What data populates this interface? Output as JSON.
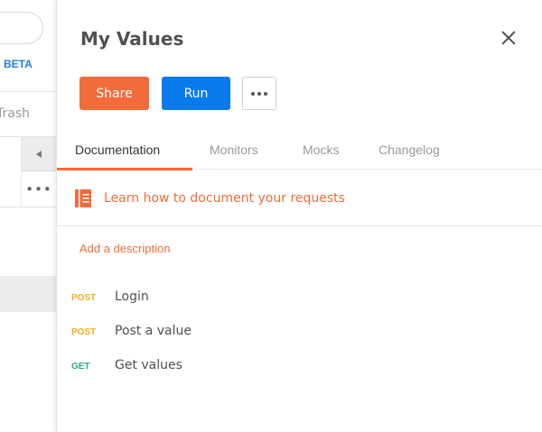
{
  "sidebar": {
    "beta_label": "BETA",
    "trash_label": "Trash",
    "more_label": "•••"
  },
  "panel": {
    "title": "My Values",
    "buttons": {
      "share": "Share",
      "run": "Run"
    },
    "tabs": [
      {
        "label": "Documentation",
        "active": true
      },
      {
        "label": "Monitors",
        "active": false
      },
      {
        "label": "Mocks",
        "active": false
      },
      {
        "label": "Changelog",
        "active": false
      }
    ],
    "doc_link": "Learn how to document your requests",
    "add_description": "Add a description",
    "requests": [
      {
        "method": "POST",
        "name": "Login"
      },
      {
        "method": "POST",
        "name": "Post a value"
      },
      {
        "method": "GET",
        "name": "Get values"
      }
    ]
  },
  "colors": {
    "accent": "#f26b3a",
    "run_blue": "#097bed",
    "beta_blue": "#1e7fd9",
    "post_method": "#f2b01e",
    "get_method": "#2aa878"
  },
  "icons": {
    "close": "close-icon",
    "more": "more-horizontal-icon",
    "book": "book-icon",
    "collapse": "chevron-left-icon"
  }
}
